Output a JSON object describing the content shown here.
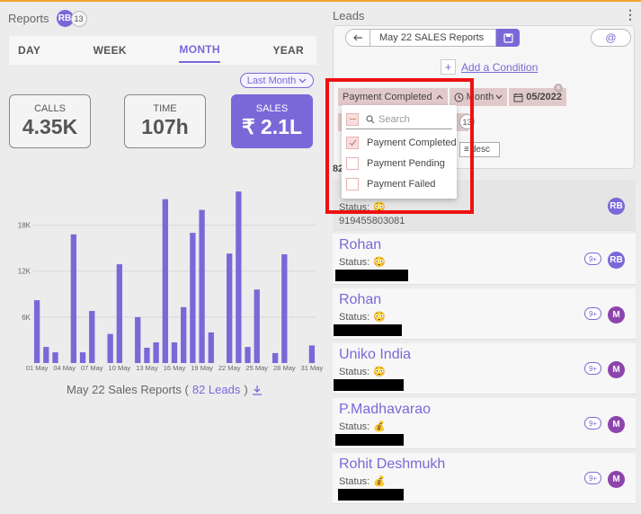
{
  "reports": {
    "title": "Reports",
    "avatar_initials": "RB",
    "avatar_count": "13",
    "tabs": [
      "DAY",
      "WEEK",
      "MONTH",
      "YEAR"
    ],
    "active_tab": "MONTH",
    "period_select": "Last Month",
    "period_chevron": "chevron-down-icon",
    "cards": [
      {
        "label": "CALLS",
        "value": "4.35K"
      },
      {
        "label": "TIME",
        "value": "107h"
      },
      {
        "label": "SALES",
        "value": "₹ 2.1L"
      }
    ],
    "caption_text": "May 22 Sales Reports (",
    "caption_link": "82 Leads",
    "caption_end": ")",
    "caption_icon": "download-icon"
  },
  "chart_data": {
    "type": "bar",
    "title": "",
    "xlabel": "",
    "ylabel": "",
    "ylim": [
      0,
      23000
    ],
    "yticks": [
      "6K",
      "12K",
      "18K"
    ],
    "xtick_labels": [
      "01 May",
      "04 May",
      "07 May",
      "10 May",
      "13 May",
      "16 May",
      "19 May",
      "22 May",
      "25 May",
      "28 May",
      "31 May"
    ],
    "grid": "horizontal",
    "bar_color": "#7b68d8",
    "values": [
      8200,
      2100,
      1400,
      0,
      16800,
      1400,
      6800,
      0,
      3800,
      12900,
      0,
      6000,
      2000,
      2700,
      21400,
      2700,
      7300,
      17000,
      20000,
      4000,
      0,
      14300,
      22400,
      2100,
      9600,
      0,
      1300,
      14200,
      0,
      0,
      2300
    ]
  },
  "leads": {
    "title": "Leads",
    "more_icon": "kebab-icon",
    "report_name": "May 22 SALES Reports",
    "back_icon": "back-arrow-icon",
    "save_icon": "save-icon",
    "at_icon": "at-icon",
    "add_condition": "Add a Condition",
    "filter_chips": [
      "Payment Completed",
      "Month",
      "05/2022"
    ],
    "sort_label": "desc",
    "small_count": "13",
    "lead_count": "82",
    "dropdown": {
      "search_placeholder": "Search",
      "options": [
        {
          "label": "Payment Completed",
          "checked": true
        },
        {
          "label": "Payment Pending",
          "checked": false
        },
        {
          "label": "Payment Failed",
          "checked": false
        }
      ]
    },
    "status_label": "Status:",
    "items": [
      {
        "name": "",
        "phone": "919455803081",
        "badge": "",
        "avatar": "RB",
        "emoji": "😳"
      },
      {
        "name": "Rohan",
        "phone": "",
        "badge": "9+",
        "avatar": "RB",
        "emoji": "😳"
      },
      {
        "name": "Rohan",
        "phone": "",
        "badge": "9+",
        "avatar": "M",
        "emoji": "😳"
      },
      {
        "name": "Uniko India",
        "phone": "",
        "badge": "9+",
        "avatar": "M",
        "emoji": "😳"
      },
      {
        "name": "P.Madhavarao",
        "phone": "",
        "badge": "9+",
        "avatar": "M",
        "emoji": "💰"
      },
      {
        "name": "Rohit Deshmukh",
        "phone": "",
        "badge": "9+",
        "avatar": "M",
        "emoji": "💰"
      }
    ]
  }
}
